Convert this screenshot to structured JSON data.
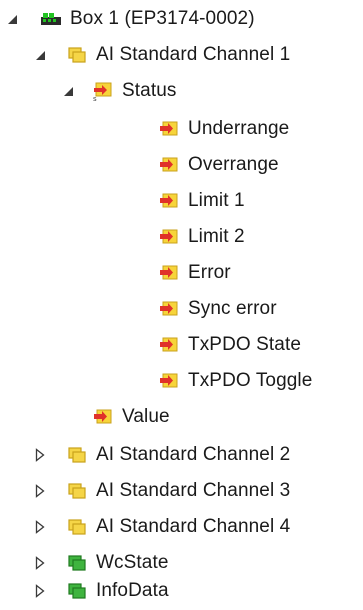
{
  "tree": {
    "nodes": [
      {
        "label": "Box 1 (EP3174-0002)",
        "icon": "box-module-icon",
        "expander": "expanded"
      },
      {
        "label": "AI Standard Channel 1",
        "icon": "folder-yellow-icon",
        "expander": "expanded"
      },
      {
        "label": "Status",
        "icon": "input-variable-struct-icon",
        "expander": "expanded"
      },
      {
        "label": "Underrange",
        "icon": "input-variable-icon",
        "expander": "none"
      },
      {
        "label": "Overrange",
        "icon": "input-variable-icon",
        "expander": "none"
      },
      {
        "label": "Limit 1",
        "icon": "input-variable-icon",
        "expander": "none"
      },
      {
        "label": "Limit 2",
        "icon": "input-variable-icon",
        "expander": "none"
      },
      {
        "label": "Error",
        "icon": "input-variable-icon",
        "expander": "none"
      },
      {
        "label": "Sync error",
        "icon": "input-variable-icon",
        "expander": "none"
      },
      {
        "label": "TxPDO State",
        "icon": "input-variable-icon",
        "expander": "none"
      },
      {
        "label": "TxPDO Toggle",
        "icon": "input-variable-icon",
        "expander": "none"
      },
      {
        "label": "Value",
        "icon": "input-variable-icon",
        "expander": "none"
      },
      {
        "label": "AI Standard Channel 2",
        "icon": "folder-yellow-icon",
        "expander": "collapsed"
      },
      {
        "label": "AI Standard Channel 3",
        "icon": "folder-yellow-icon",
        "expander": "collapsed"
      },
      {
        "label": "AI Standard Channel 4",
        "icon": "folder-yellow-icon",
        "expander": "collapsed"
      },
      {
        "label": "WcState",
        "icon": "folder-green-icon",
        "expander": "collapsed"
      },
      {
        "label": "InfoData",
        "icon": "folder-green-icon",
        "expander": "collapsed"
      }
    ]
  },
  "colors": {
    "folder_yellow": "#f5d547",
    "folder_yellow_border": "#c9a21c",
    "folder_green": "#3fb43f",
    "folder_green_border": "#1f7a1f",
    "variable_red": "#e0322a",
    "variable_yellow": "#f7d43a",
    "box_green": "#22c322",
    "box_dark": "#2a2a2a"
  }
}
